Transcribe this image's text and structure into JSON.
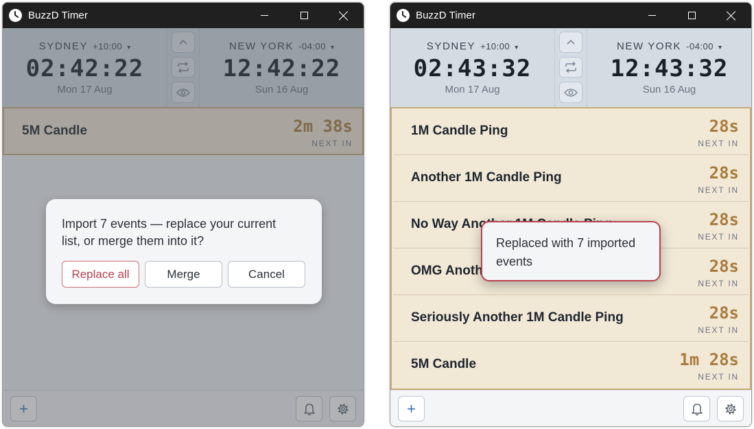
{
  "app": {
    "title": "BuzzD Timer"
  },
  "colors": {
    "titlebar": "#202020",
    "clock_panel": "#d4dbe3",
    "event_bg": "#f2e8d6",
    "event_border": "#c8ab7a",
    "countdown": "#a87c3e",
    "danger": "#b6414f",
    "accent": "#3a6fb8"
  },
  "left": {
    "clocks": [
      {
        "city": "SYDNEY",
        "offset": "+10:00",
        "time": "02:42:22",
        "date": "Mon 17 Aug"
      },
      {
        "city": "NEW YORK",
        "offset": "-04:00",
        "time": "12:42:22",
        "date": "Sun 16 Aug"
      }
    ],
    "events": [
      {
        "name": "5M Candle",
        "countdown": "2m 38s",
        "label": "NEXT IN"
      }
    ],
    "dialog": {
      "message": "Import 7 events — replace your current list, or merge them into it?",
      "replace_label": "Replace all",
      "merge_label": "Merge",
      "cancel_label": "Cancel"
    }
  },
  "right": {
    "clocks": [
      {
        "city": "SYDNEY",
        "offset": "+10:00",
        "time": "02:43:32",
        "date": "Mon 17 Aug"
      },
      {
        "city": "NEW YORK",
        "offset": "-04:00",
        "time": "12:43:32",
        "date": "Sun 16 Aug"
      }
    ],
    "events": [
      {
        "name": "1M Candle Ping",
        "countdown": "28s",
        "label": "NEXT IN"
      },
      {
        "name": "Another 1M Candle Ping",
        "countdown": "28s",
        "label": "NEXT IN"
      },
      {
        "name": "No Way Another 1M Candle Ping",
        "countdown": "28s",
        "label": "NEXT IN"
      },
      {
        "name": "OMG Another 1M Candle Ping",
        "countdown": "28s",
        "label": "NEXT IN"
      },
      {
        "name": "Seriously Another 1M Candle Ping",
        "countdown": "28s",
        "label": "NEXT IN"
      },
      {
        "name": "5M Candle",
        "countdown": "1m 28s",
        "label": "NEXT IN"
      }
    ],
    "toast": {
      "message": "Replaced with 7 imported events"
    }
  },
  "controls": {
    "up_icon": "chevron-up-icon",
    "swap_icon": "swap-icon",
    "view_icon": "eye-icon",
    "caret": "▾",
    "add_label": "+",
    "bell_icon": "bell-icon",
    "settings_icon": "gear-icon"
  }
}
